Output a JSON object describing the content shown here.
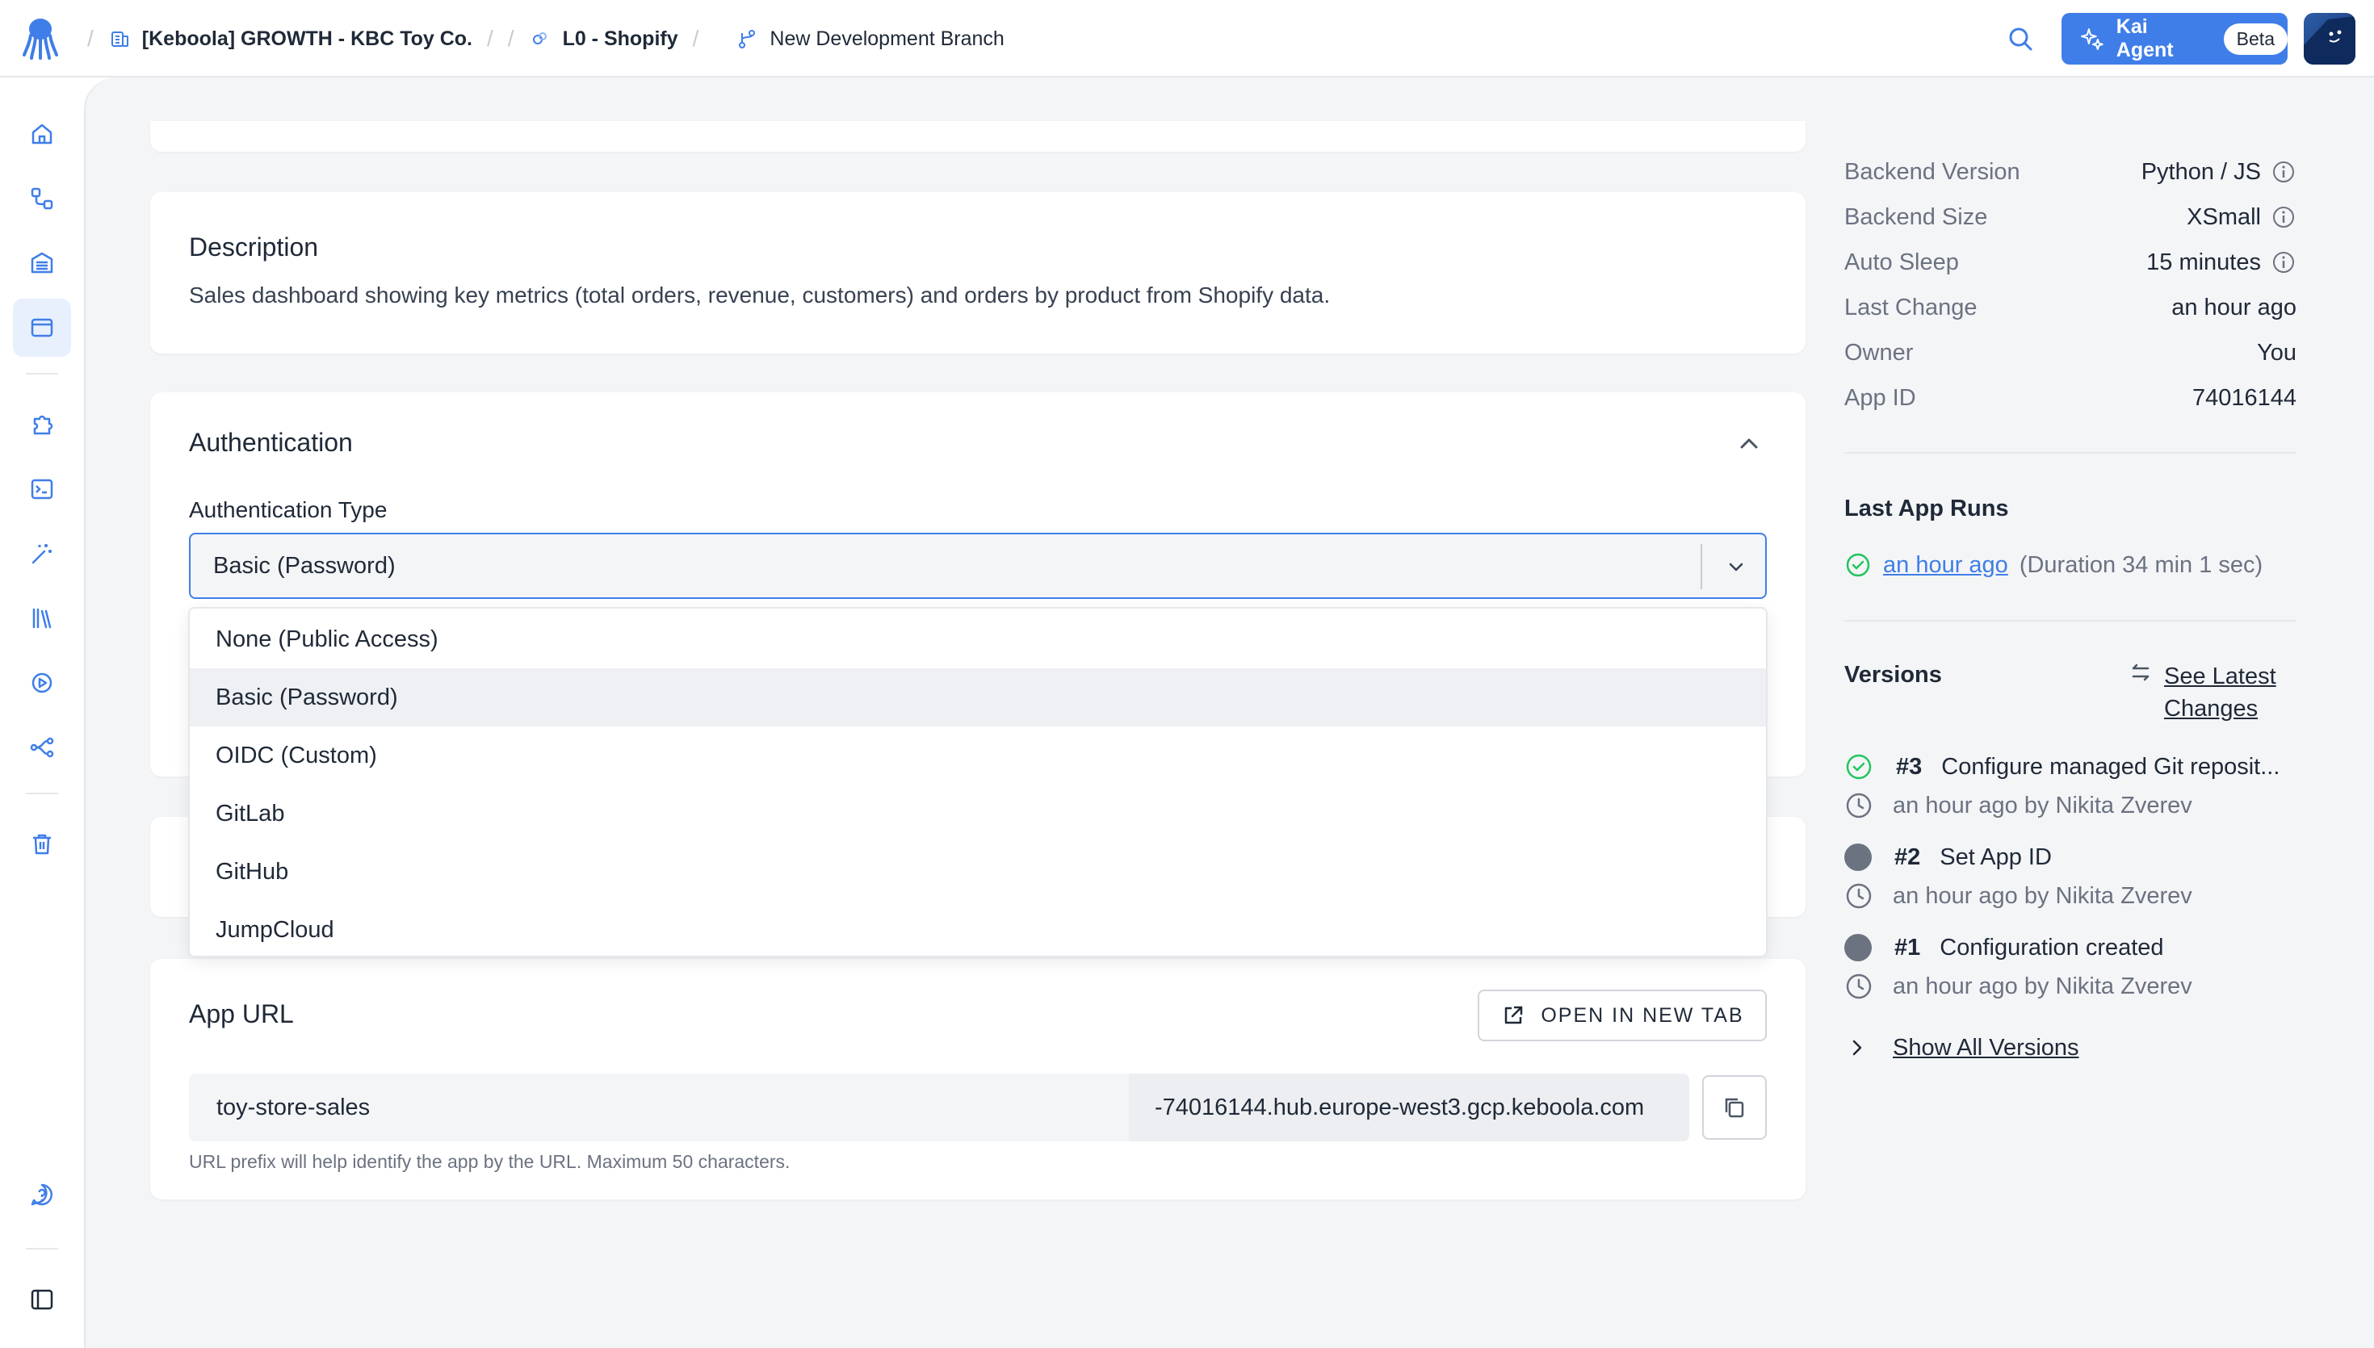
{
  "header": {
    "breadcrumbs": [
      {
        "label": "[Keboola] GROWTH - KBC Toy Co.",
        "icon": "building-icon"
      },
      {
        "label": "L0 - Shopify",
        "icon": "component-icon"
      },
      {
        "label": "New Development Branch",
        "icon": "branch-icon"
      }
    ],
    "separator": "/",
    "kai_label": "Kai Agent",
    "kai_badge": "Beta"
  },
  "sidebar": {
    "items": [
      "home-icon",
      "flows-icon",
      "storage-icon",
      "apps-icon",
      "components-icon",
      "transformations-icon",
      "workspaces-icon",
      "templates-icon",
      "jobs-icon",
      "lineage-icon",
      "trash-icon",
      "help-icon",
      "collapse-sidebar-icon"
    ]
  },
  "description": {
    "title": "Description",
    "text": "Sales dashboard showing key metrics (total orders, revenue, customers) and orders by product from Shopify data."
  },
  "authentication": {
    "title": "Authentication",
    "field_label": "Authentication Type",
    "selected": "Basic (Password)",
    "options": [
      "None (Public Access)",
      "Basic (Password)",
      "OIDC (Custom)",
      "GitLab",
      "GitHub",
      "JumpCloud"
    ]
  },
  "app_url": {
    "title": "App URL",
    "open_button": "OPEN IN NEW TAB",
    "prefix": "toy-store-sales",
    "suffix": "-74016144.hub.europe-west3.gcp.keboola.com",
    "help": "URL prefix will help identify the app by the URL. Maximum 50 characters."
  },
  "details": [
    {
      "key": "Backend Version",
      "value": "Python / JS",
      "info": true
    },
    {
      "key": "Backend Size",
      "value": "XSmall",
      "info": true
    },
    {
      "key": "Auto Sleep",
      "value": "15 minutes",
      "info": true
    },
    {
      "key": "Last Change",
      "value": "an hour ago",
      "info": false
    },
    {
      "key": "Owner",
      "value": "You",
      "info": false
    },
    {
      "key": "App ID",
      "value": "74016144",
      "info": false
    }
  ],
  "last_runs": {
    "title": "Last App Runs",
    "time": "an hour ago",
    "duration": "(Duration 34 min 1 sec)"
  },
  "versions": {
    "title": "Versions",
    "see_latest_line1": "See Latest",
    "see_latest_line2": "Changes",
    "items": [
      {
        "num": "#3",
        "desc": "Configure managed Git reposit...",
        "meta": "an hour ago by Nikita Zverev",
        "status": "success"
      },
      {
        "num": "#2",
        "desc": "Set App ID",
        "meta": "an hour ago by Nikita Zverev",
        "status": "neutral"
      },
      {
        "num": "#1",
        "desc": "Configuration created",
        "meta": "an hour ago by Nikita Zverev",
        "status": "neutral"
      }
    ],
    "show_all": "Show All Versions"
  },
  "colors": {
    "accent": "#3f7ee8",
    "success": "#22c55e",
    "muted": "#6b7280"
  }
}
